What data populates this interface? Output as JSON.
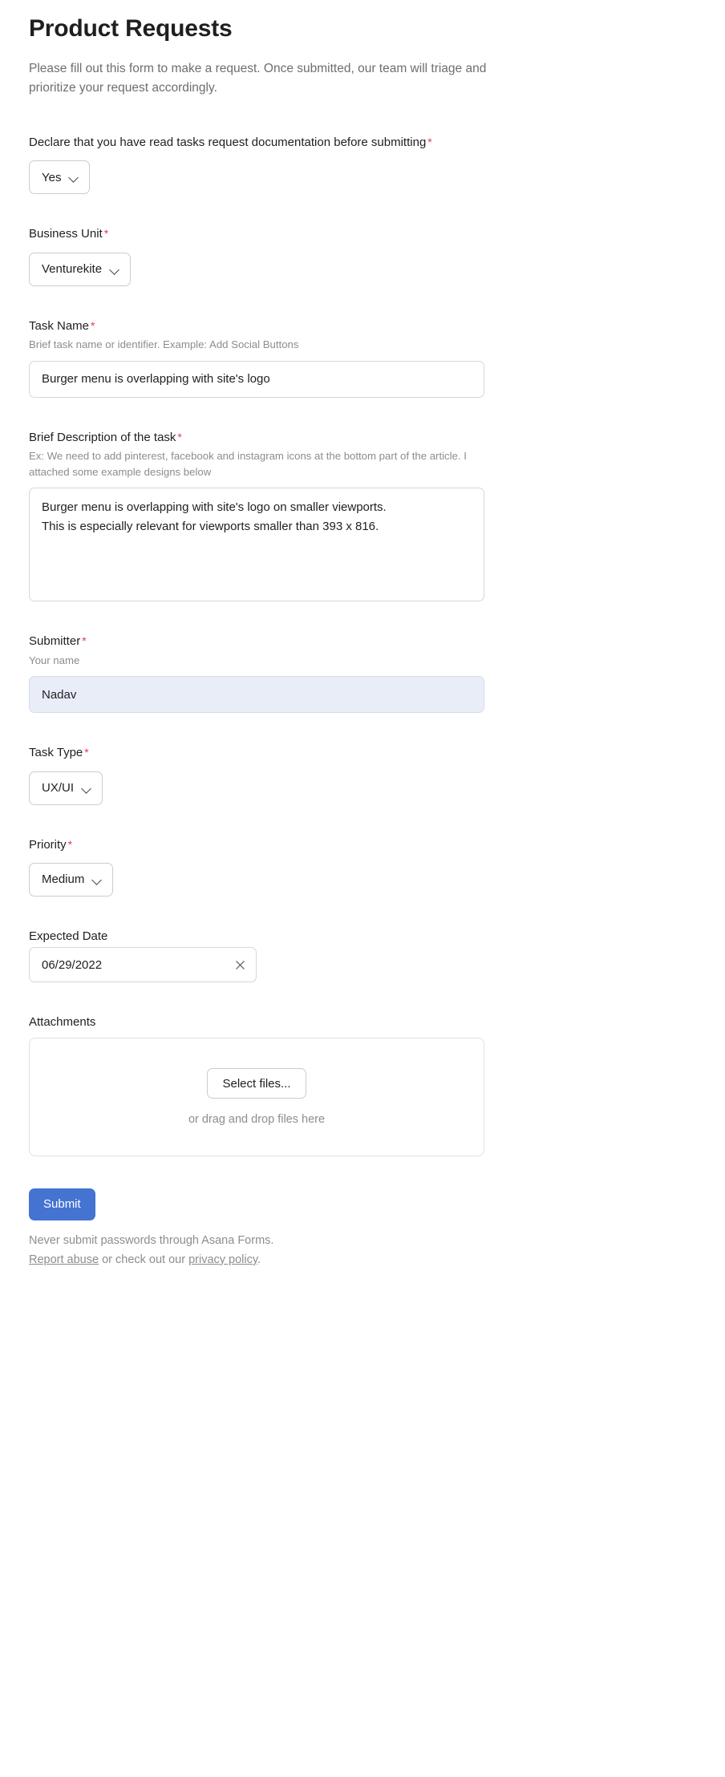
{
  "page": {
    "title": "Product Requests",
    "intro": "Please fill out this form to make a request. Once submitted, our team will triage and prioritize your request accordingly."
  },
  "fields": {
    "declaration": {
      "label": "Declare that you have read tasks request documentation before submitting",
      "required_marker": "*",
      "value": "Yes",
      "chevron_icon": "chevron-down-icon"
    },
    "business_unit": {
      "label": "Business Unit",
      "required_marker": "*",
      "value": "Venturekite",
      "chevron_icon": "chevron-down-icon"
    },
    "task_name": {
      "label": "Task Name",
      "required_marker": "*",
      "help": "Brief task name or identifier. Example: Add Social Buttons",
      "value": "Burger menu is overlapping with site's logo",
      "placeholder": ""
    },
    "description": {
      "label": "Brief Description of the task",
      "required_marker": "*",
      "help": "Ex: We need to add pinterest, facebook and instagram icons at the bottom part of the article. I attached some example designs below",
      "value": "Burger menu is overlapping with site's logo on smaller viewports.\nThis is especially relevant for viewports smaller than 393 x 816.",
      "placeholder": ""
    },
    "submitter": {
      "label": "Submitter",
      "required_marker": "*",
      "help": "Your name",
      "value": "Nadav",
      "placeholder": ""
    },
    "task_type": {
      "label": "Task Type",
      "required_marker": "*",
      "value": "UX/UI",
      "chevron_icon": "chevron-down-icon"
    },
    "priority": {
      "label": "Priority",
      "required_marker": "*",
      "value": "Medium",
      "chevron_icon": "chevron-down-icon"
    },
    "expected_date": {
      "label": "Expected Date",
      "value": "06/29/2022",
      "placeholder": "",
      "clear_icon": "close-icon"
    },
    "attachments": {
      "label": "Attachments",
      "select_button": "Select files...",
      "drag_hint": "or drag and drop files here"
    }
  },
  "actions": {
    "submit_label": "Submit"
  },
  "footer": {
    "warning": "Never submit passwords through Asana Forms.",
    "report_link": "Report abuse",
    "middle_text": " or check out our ",
    "privacy_link": "privacy policy",
    "period": "."
  },
  "colors": {
    "accent": "#4573d2",
    "required": "#e8384f",
    "focused_field_bg": "#e9edf8"
  }
}
